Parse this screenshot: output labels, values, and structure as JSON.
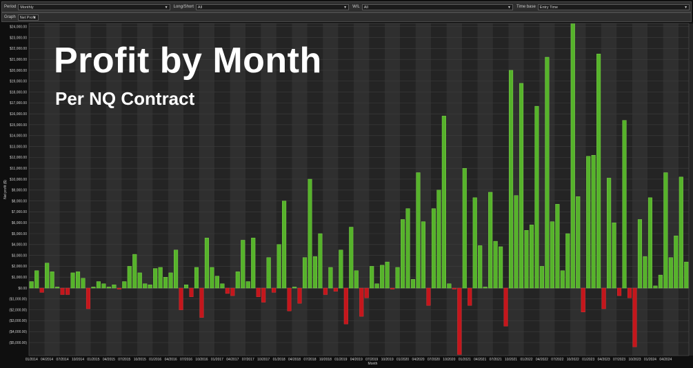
{
  "toolbar": {
    "period_label": "Period",
    "period_value": "Monthly",
    "longshort_label": "Long/Short",
    "longshort_value": "All",
    "wl_label": "W/L",
    "wl_value": "All",
    "timebase_label": "Time base",
    "timebase_value": "Entry Time"
  },
  "graph": {
    "label": "Graph",
    "value": "Net Profit"
  },
  "overlay": {
    "title": "Profit by Month",
    "subtitle": "Per NQ Contract"
  },
  "colors": {
    "positive": "#56b32b",
    "negative": "#c4161c",
    "background": "#1c1c1c"
  },
  "chart_data": {
    "type": "bar",
    "title": "Profit by Month",
    "subtitle": "Per NQ Contract",
    "xlabel": "Month",
    "ylabel": "Net profit ($)",
    "ylim": [
      -6200,
      24300
    ],
    "yticks": [
      "$24,000.00",
      "$23,000.00",
      "$22,000.00",
      "$21,000.00",
      "$20,000.00",
      "$19,000.00",
      "$18,000.00",
      "$17,000.00",
      "$16,000.00",
      "$15,000.00",
      "$14,000.00",
      "$13,000.00",
      "$12,000.00",
      "$11,000.00",
      "$10,000.00",
      "$9,000.00",
      "$8,000.00",
      "$7,000.00",
      "$6,000.00",
      "$5,000.00",
      "$4,000.00",
      "$3,000.00",
      "$2,000.00",
      "$1,000.00",
      "$0.00",
      "($1,000.00)",
      "($2,000.00)",
      "($3,000.00)",
      "($4,000.00)",
      "($5,000.00)"
    ],
    "ytick_values": [
      24000,
      23000,
      22000,
      21000,
      20000,
      19000,
      18000,
      17000,
      16000,
      15000,
      14000,
      13000,
      12000,
      11000,
      10000,
      9000,
      8000,
      7000,
      6000,
      5000,
      4000,
      3000,
      2000,
      1000,
      0,
      -1000,
      -2000,
      -3000,
      -4000,
      -5000
    ],
    "xtick_labels": [
      "01/2014",
      "04/2014",
      "07/2014",
      "10/2014",
      "01/2015",
      "04/2015",
      "07/2015",
      "10/2015",
      "01/2016",
      "04/2016",
      "07/2016",
      "10/2016",
      "01/2017",
      "04/2017",
      "07/2017",
      "10/2017",
      "01/2018",
      "04/2018",
      "07/2018",
      "10/2018",
      "01/2019",
      "04/2019",
      "07/2019",
      "10/2019",
      "01/2020",
      "04/2020",
      "07/2020",
      "10/2020",
      "01/2021",
      "04/2021",
      "07/2021",
      "10/2021",
      "01/2022",
      "04/2022",
      "07/2022",
      "10/2022",
      "01/2023",
      "04/2023",
      "07/2023",
      "10/2023",
      "01/2024",
      "04/2024"
    ],
    "start_month": "01/2014",
    "values": [
      600,
      1600,
      -400,
      2300,
      1500,
      100,
      -600,
      -600,
      1400,
      1500,
      900,
      -1900,
      100,
      600,
      400,
      100,
      300,
      -100,
      600,
      2000,
      3100,
      1400,
      400,
      300,
      1800,
      1900,
      1000,
      1400,
      3500,
      -2000,
      300,
      -800,
      1900,
      -2700,
      4600,
      1900,
      1100,
      400,
      -500,
      -700,
      1500,
      4400,
      600,
      4600,
      -800,
      -1300,
      2800,
      -400,
      4000,
      8000,
      -2100,
      100,
      -1400,
      2800,
      10000,
      2900,
      5000,
      -600,
      1900,
      -300,
      3500,
      -3300,
      5600,
      1600,
      -2600,
      -900,
      2000,
      400,
      2100,
      2400,
      -100,
      1900,
      6300,
      7300,
      800,
      10600,
      6100,
      -1600,
      7300,
      9000,
      15800,
      400,
      -100,
      -6100,
      11000,
      -1600,
      8300,
      3900,
      100,
      8800,
      4300,
      3800,
      -3500,
      20000,
      8500,
      18800,
      5300,
      5800,
      16700,
      2000,
      21200,
      6100,
      7700,
      1600,
      5000,
      24300,
      8400,
      -2200,
      12100,
      12200,
      21500,
      -1900,
      10100,
      6000,
      -700,
      15400,
      -900,
      -5400,
      6300,
      2900,
      8300,
      200,
      1200,
      10600,
      2800,
      4800,
      10200,
      2400
    ]
  }
}
